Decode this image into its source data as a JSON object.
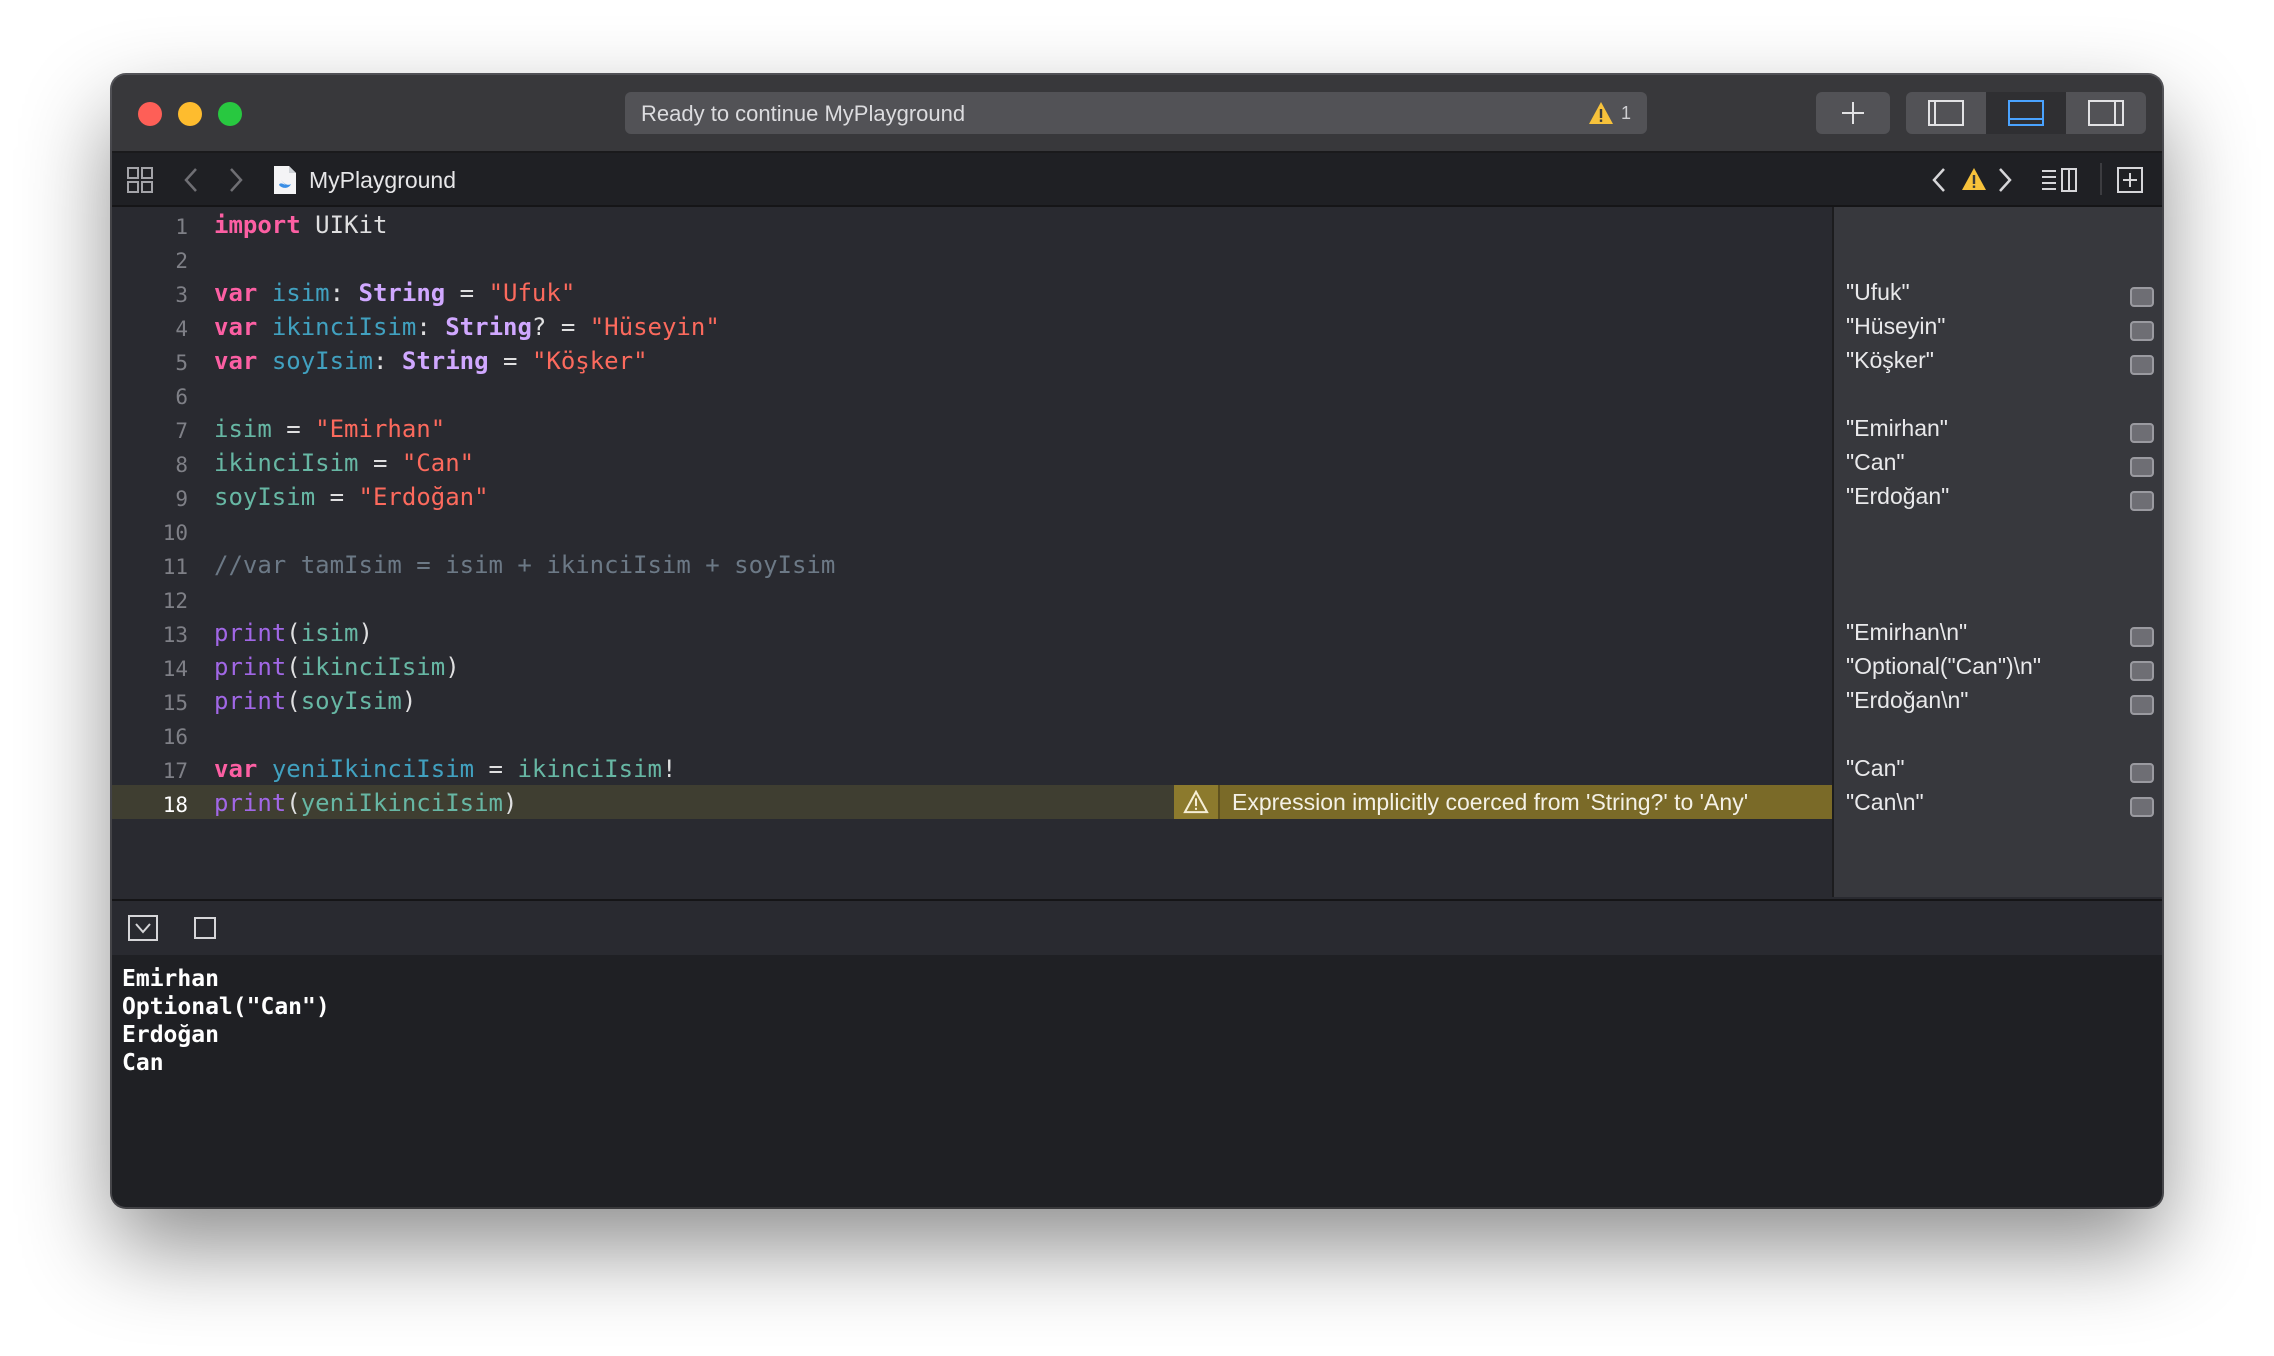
{
  "titlebar": {
    "status": "Ready to continue MyPlayground",
    "warning_count": "1",
    "add_icon": "plus-icon",
    "panel_icons": [
      "left-panel-icon",
      "bottom-panel-icon",
      "right-panel-icon"
    ],
    "active_panel_color": "#4aa3ff"
  },
  "jumpbar": {
    "filename": "MyPlayground"
  },
  "editor": {
    "line_numbers": [
      "1",
      "2",
      "3",
      "4",
      "5",
      "6",
      "7",
      "8",
      "9",
      "10",
      "11",
      "12",
      "13",
      "14",
      "15",
      "16",
      "17",
      "18"
    ],
    "warning_message": "Expression implicitly coerced from 'String?' to 'Any'"
  },
  "results": {
    "values": [
      "\"Ufuk\"",
      "\"Hüseyin\"",
      "\"Köşker\"",
      "\"Emirhan\"",
      "\"Can\"",
      "\"Erdoğan\"",
      "\"Emirhan\\n\"",
      "\"Optional(\"Can\")\\n\"",
      "\"Erdoğan\\n\"",
      "\"Can\"",
      "\"Can\\n\""
    ]
  },
  "console": {
    "lines": [
      "Emirhan",
      "Optional(\"Can\")",
      "Erdoğan",
      "Can"
    ]
  },
  "colors": {
    "keyword": "#fc5fa3",
    "string": "#fc6a5d",
    "type": "#d0a8ff",
    "identifier": "#41a1c0",
    "function": "#a167e6",
    "comment": "#6c7986",
    "warning_yellow": "#f7c23b"
  }
}
